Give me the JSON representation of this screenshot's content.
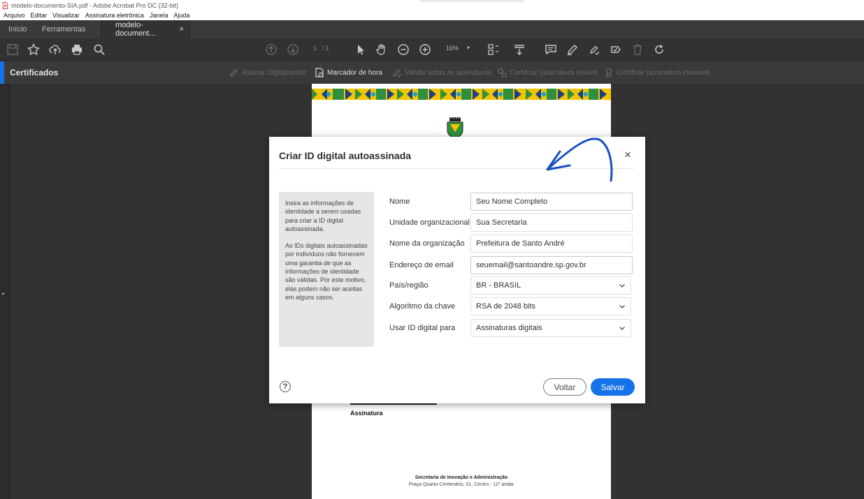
{
  "window": {
    "title": "modelo-documento-SIA.pdf - Adobe Acrobat Pro DC (32-bit)"
  },
  "menu": [
    "Arquivo",
    "Editar",
    "Visualizar",
    "Assinatura eletrônica",
    "Janela",
    "Ajuda"
  ],
  "tabs": {
    "home": "Início",
    "tools": "Ferramentas",
    "document": "modelo-document...",
    "close": "×"
  },
  "toolbar": {
    "page_current": "1",
    "page_total": "/ 1",
    "zoom": "16%"
  },
  "certbar": {
    "title": "Certificados",
    "sign_digitally": "Assinar Digitalmente",
    "timestamp": "Marcador de hora",
    "validate_all": "Validar todas as assinaturas",
    "certify_visible": "Certificar (assinatura visível)",
    "certify_invisible": "Certificar (assinatura invisível)"
  },
  "document": {
    "signature_label": "Assinatura",
    "footer_line1": "Secretaria de Inovação e Administração",
    "footer_line2": "Praça Quarto Centenário, 01, Centro - 11º andar"
  },
  "dialog": {
    "title": "Criar ID digital autoassinada",
    "close": "×",
    "info_p1": "Insira as informações de identidade a serem usadas para criar a ID digital autoassinada.",
    "info_p2": "As IDs digitais autoassinadas por indivíduos não fornecem uma garantia de que as informações de identidade são válidas. Por este motivo, elas podem não ser aceitas em alguns casos.",
    "fields": {
      "name": {
        "label": "Nome",
        "value": "Seu Nome Completo"
      },
      "org_unit": {
        "label": "Unidade organizacional",
        "value": "Sua Secretaria"
      },
      "org_name": {
        "label": "Nome da organização",
        "value": "Prefeitura de Santo André"
      },
      "email": {
        "label": "Endereço de email",
        "value": "seuemail@santoandre.sp.gov.br"
      },
      "country": {
        "label": "País/região",
        "value": "BR - BRASIL"
      },
      "key_algorithm": {
        "label": "Algoritmo da chave",
        "value": "RSA de 2048 bits"
      },
      "use_for": {
        "label": "Usar ID digital para",
        "value": "Assinaturas digitais"
      }
    },
    "help": "?",
    "back_label": "Voltar",
    "save_label": "Salvar"
  },
  "colors": {
    "accent": "#1473e6",
    "annotation": "#1a4fc4"
  }
}
